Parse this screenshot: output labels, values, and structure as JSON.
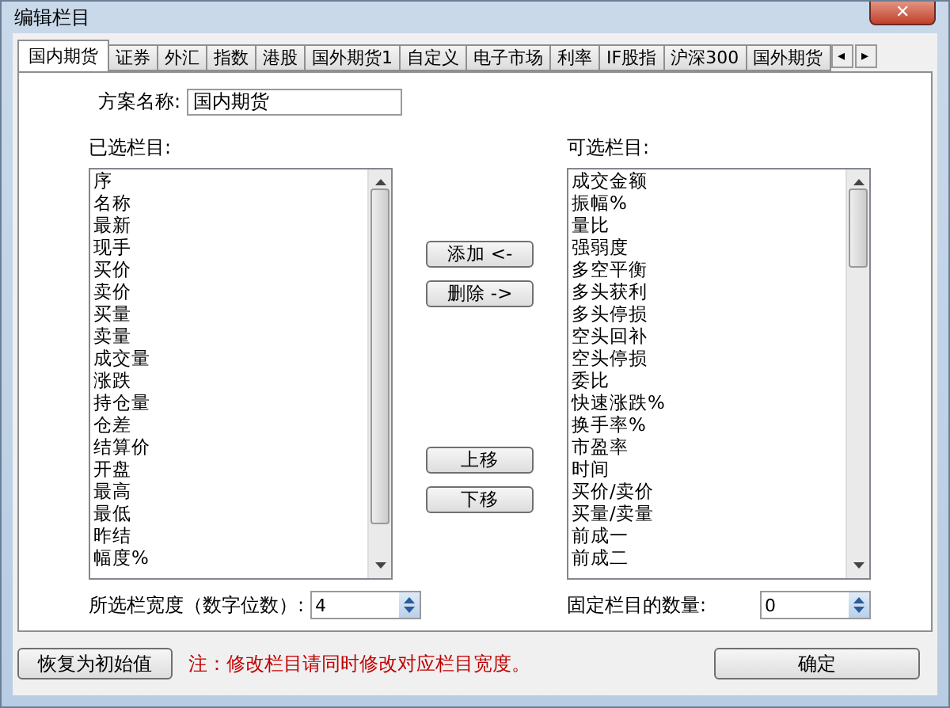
{
  "window": {
    "title": "编辑栏目",
    "close": "✕"
  },
  "tabs": [
    {
      "label": "国内期货",
      "selected": true
    },
    {
      "label": "证券",
      "selected": false
    },
    {
      "label": "外汇",
      "selected": false
    },
    {
      "label": "指数",
      "selected": false
    },
    {
      "label": "港股",
      "selected": false
    },
    {
      "label": "国外期货1",
      "selected": false
    },
    {
      "label": "自定义",
      "selected": false
    },
    {
      "label": "电子市场",
      "selected": false
    },
    {
      "label": "利率",
      "selected": false
    },
    {
      "label": "IF股指",
      "selected": false
    },
    {
      "label": "沪深300",
      "selected": false
    },
    {
      "label": "国外期货",
      "selected": false
    }
  ],
  "tab_scroll": [
    "◂",
    "▸"
  ],
  "scheme": {
    "label": "方案名称:",
    "value": "国内期货"
  },
  "selected_columns": {
    "label": "已选栏目:",
    "items": [
      "序",
      "名称",
      "最新",
      "现手",
      "买价",
      "卖价",
      "买量",
      "卖量",
      "成交量",
      "涨跌",
      "持仓量",
      "仓差",
      "结算价",
      "开盘",
      "最高",
      "最低",
      "昨结",
      "幅度%"
    ]
  },
  "available_columns": {
    "label": "可选栏目:",
    "items": [
      "成交金额",
      "振幅%",
      "量比",
      "强弱度",
      "多空平衡",
      "多头获利",
      "多头停损",
      "空头回补",
      "空头停损",
      "委比",
      "快速涨跌%",
      "换手率%",
      "市盈率",
      "时间",
      "买价/卖价",
      "买量/卖量",
      "前成一",
      "前成二"
    ]
  },
  "middle_buttons": [
    {
      "label": "添加 <-"
    },
    {
      "label": "删除 ->"
    },
    {
      "label": "上移"
    },
    {
      "label": "下移"
    }
  ],
  "width_field": {
    "label": "所选栏宽度（数字位数）:",
    "value": "4"
  },
  "fixed_field": {
    "label": "固定栏目的数量:",
    "value": "0"
  },
  "footer": {
    "reset": "恢复为初始值",
    "note": "注：修改栏目请同时修改对应栏目宽度。",
    "ok": "确定"
  }
}
